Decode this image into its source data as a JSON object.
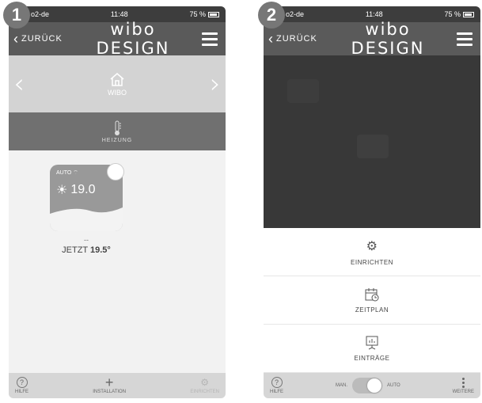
{
  "steps": [
    "1",
    "2"
  ],
  "status": {
    "carrier": "o2-de",
    "time": "11:48",
    "battery": "75 %"
  },
  "nav": {
    "back": "ZURÜCK",
    "brand": "wibo DESIGN"
  },
  "screen1": {
    "hero_label": "WIBO",
    "section_label": "HEIZUNG",
    "tile": {
      "mode": "AUTO",
      "temperature": "19.0"
    },
    "dash": "--",
    "now_prefix": "JETZT",
    "now_value": "19.5°",
    "tabbar": {
      "help": "HILFE",
      "install": "INSTALLATION",
      "setup": "EINRICHTEN"
    }
  },
  "screen2": {
    "menu": [
      "EINRICHTEN",
      "ZEITPLAN",
      "EINTRÄGE"
    ],
    "tabbar": {
      "help": "HILFE",
      "manual": "MAN.",
      "auto": "AUTO",
      "more": "WEITERE"
    }
  },
  "colors": {
    "navbar": "#5a5a5a",
    "dark_panel": "#383838",
    "accent": "#ffffff"
  }
}
